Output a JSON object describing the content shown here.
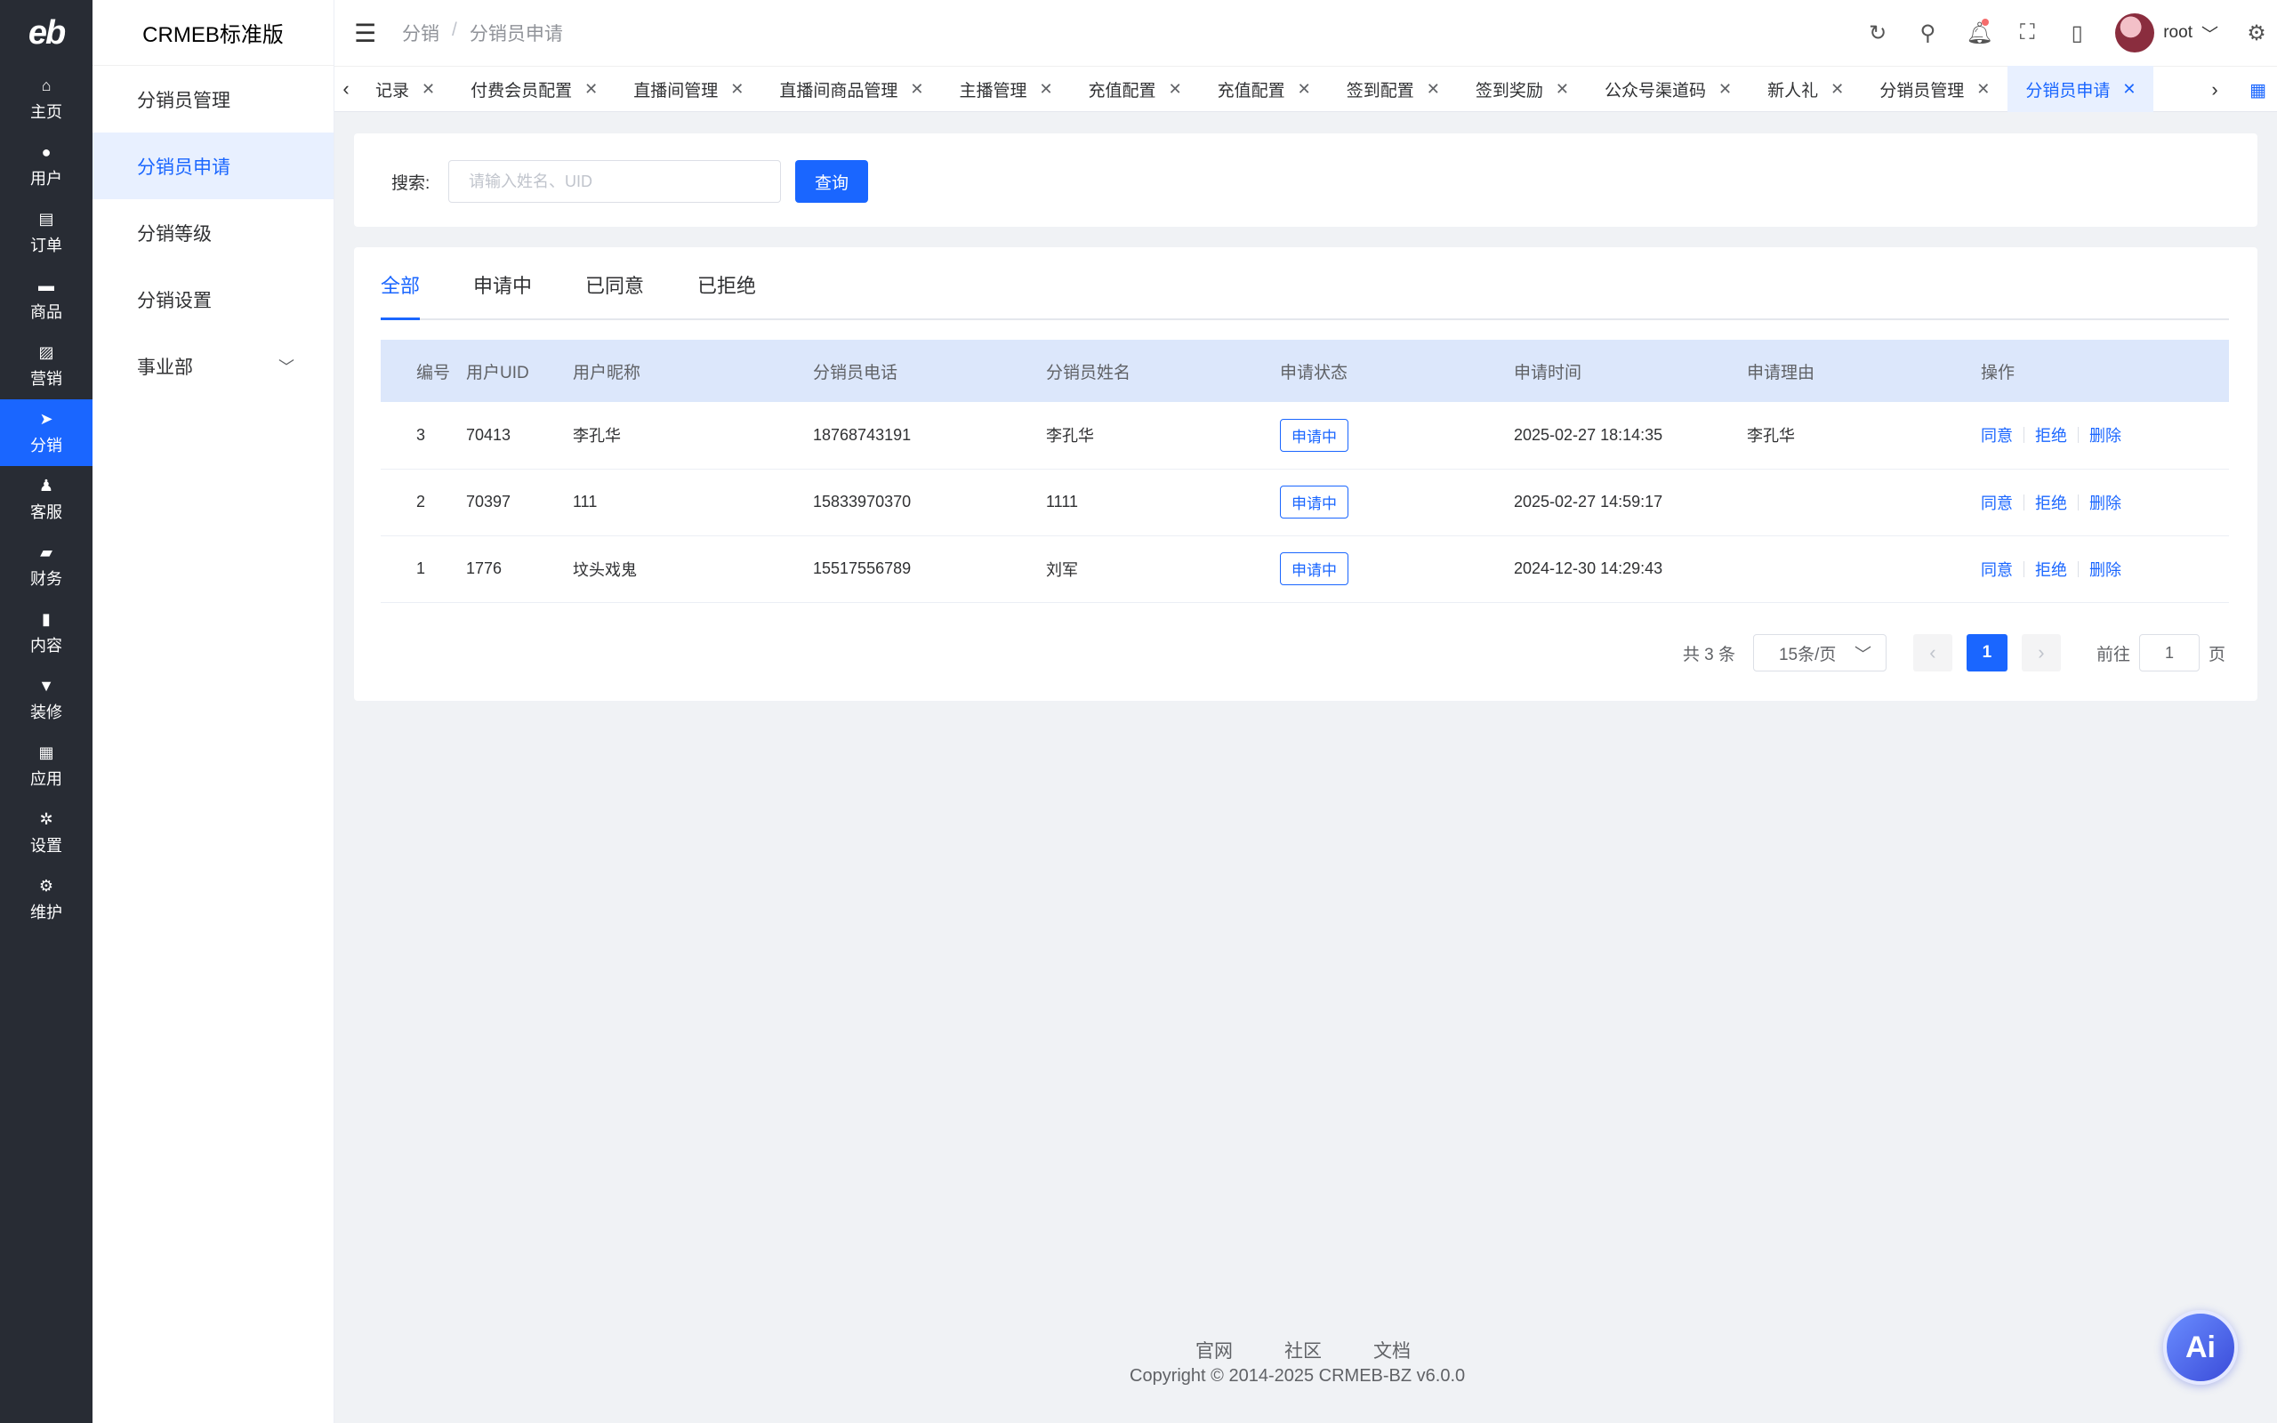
{
  "rail": {
    "logo": "eb",
    "items": [
      {
        "label": "主页",
        "icon": "⌂"
      },
      {
        "label": "用户",
        "icon": "●"
      },
      {
        "label": "订单",
        "icon": "▤"
      },
      {
        "label": "商品",
        "icon": "▬"
      },
      {
        "label": "营销",
        "icon": "▨"
      },
      {
        "label": "分销",
        "icon": "➤"
      },
      {
        "label": "客服",
        "icon": "♟"
      },
      {
        "label": "财务",
        "icon": "▰"
      },
      {
        "label": "内容",
        "icon": "▮"
      },
      {
        "label": "装修",
        "icon": "▼"
      },
      {
        "label": "应用",
        "icon": "▦"
      },
      {
        "label": "设置",
        "icon": "✲"
      },
      {
        "label": "维护",
        "icon": "⚙"
      }
    ]
  },
  "sub": {
    "brand": "CRMEB标准版",
    "items": [
      "分销员管理",
      "分销员申请",
      "分销等级",
      "分销设置",
      "事业部"
    ]
  },
  "header": {
    "crumb1": "分销",
    "crumb_sep": "/",
    "crumb2": "分销员申请",
    "user": "root"
  },
  "tabs": [
    "记录",
    "付费会员配置",
    "直播间管理",
    "直播间商品管理",
    "主播管理",
    "充值配置",
    "充值配置",
    "签到配置",
    "签到奖励",
    "公众号渠道码",
    "新人礼",
    "分销员管理",
    "分销员申请"
  ],
  "search": {
    "label": "搜索:",
    "placeholder": "请输入姓名、UID",
    "button": "查询"
  },
  "filter_tabs": [
    "全部",
    "申请中",
    "已同意",
    "已拒绝"
  ],
  "table": {
    "headers": [
      "编号",
      "用户UID",
      "用户昵称",
      "分销员电话",
      "分销员姓名",
      "申请状态",
      "申请时间",
      "申请理由",
      "操作"
    ],
    "rows": [
      {
        "id": "3",
        "uid": "70413",
        "nickname": "李孔华",
        "phone": "18768743191",
        "name": "李孔华",
        "status": "申请中",
        "time": "2025-02-27 18:14:35",
        "reason": "李孔华"
      },
      {
        "id": "2",
        "uid": "70397",
        "nickname": "111",
        "phone": "15833970370",
        "name": "1111",
        "status": "申请中",
        "time": "2025-02-27 14:59:17",
        "reason": ""
      },
      {
        "id": "1",
        "uid": "1776",
        "nickname": "坟头戏鬼",
        "phone": "15517556789",
        "name": "刘军",
        "status": "申请中",
        "time": "2024-12-30 14:29:43",
        "reason": ""
      }
    ],
    "actions": {
      "agree": "同意",
      "reject": "拒绝",
      "delete": "删除"
    }
  },
  "pagination": {
    "total": "共 3 条",
    "page_size": "15条/页",
    "current": "1",
    "goto_prefix": "前往",
    "goto_value": "1",
    "goto_suffix": "页"
  },
  "footer": {
    "links": [
      "官网",
      "社区",
      "文档"
    ],
    "copyright": "Copyright © 2014-2025 CRMEB-BZ v6.0.0"
  },
  "ai_button": "Ai",
  "colors": {
    "primary": "#1a66ff",
    "rail_bg": "#282c34",
    "page_bg": "#f0f2f5"
  }
}
